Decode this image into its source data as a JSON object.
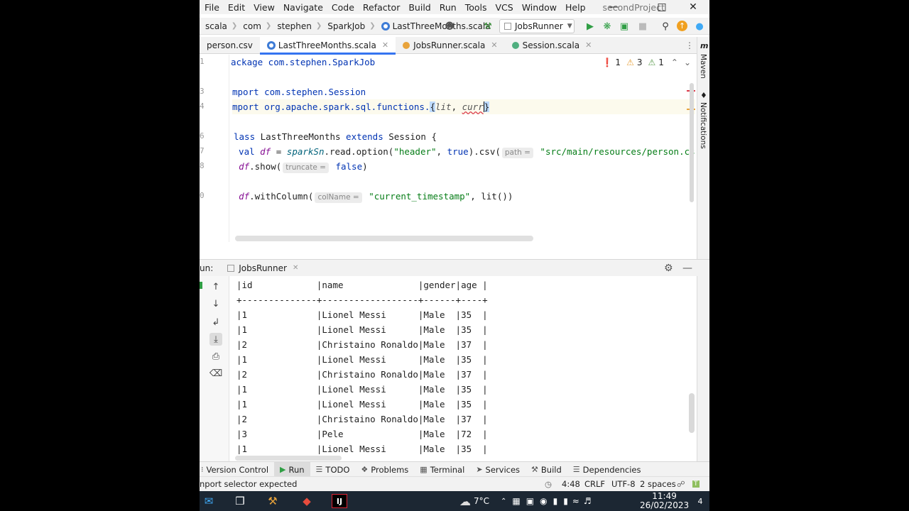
{
  "menu": {
    "items": [
      "File",
      "Edit",
      "View",
      "Navigate",
      "Code",
      "Refactor",
      "Build",
      "Run",
      "Tools",
      "VCS",
      "Window",
      "Help"
    ],
    "project_title": "secondProject"
  },
  "navbar": {
    "crumbs": [
      "scala",
      "com",
      "stephen",
      "SparkJob",
      "LastThreeMonths.scala"
    ],
    "run_config": "JobsRunner"
  },
  "tabs": [
    {
      "label": "person.csv"
    },
    {
      "label": "LastThreeMonths.scala"
    },
    {
      "label": "JobsRunner.scala"
    },
    {
      "label": "Session.scala"
    }
  ],
  "editor": {
    "line_numbers": [
      "1",
      "",
      "3",
      "4",
      "",
      "6",
      "7",
      "8",
      "",
      "0",
      "",
      "",
      ""
    ],
    "issues": {
      "errors": "1",
      "warnings": "3",
      "weak": "1"
    },
    "lines": {
      "l1": {
        "a": "ackage com.stephen.SparkJob"
      },
      "l3": {
        "a": "mport com.stephen.Session"
      },
      "l4": {
        "a": "mport org.apache.spark.sql.functions.",
        "b": "{",
        "c": "lit",
        "d": ", ",
        "e": "curr",
        "f": "}"
      },
      "l6": {
        "a": "lass",
        "b": " LastThreeMonths ",
        "c": "extends",
        "d": " Session {"
      },
      "l7": {
        "a": "  val ",
        "b": "df",
        "c": " = ",
        "d": "sparkSn",
        "e": ".read.option(",
        "f": "\"header\"",
        "g": ", ",
        "h": "true",
        "i": ").csv(",
        "hint": "path =",
        "j": " \"src/main/resources/person.cs"
      },
      "l8": {
        "a": "  ",
        "b": "df",
        "c": ".show(",
        "hint": "truncate =",
        "d": " false",
        "e": ")"
      },
      "l10": {
        "a": "  ",
        "b": "df",
        "c": ".withColumn(",
        "hint": "colName =",
        "d": " \"current_timestamp\"",
        "e": ", lit())"
      }
    }
  },
  "run": {
    "prefix": "un:",
    "config_tab": "JobsRunner",
    "header_line": "|id            |name              |gender|age |",
    "separator_line": "+--------------+------------------+------+----+",
    "rows": [
      "|1             |Lionel Messi      |Male  |35  |",
      "|1             |Lionel Messi      |Male  |35  |",
      "|2             |Christaino Ronaldo|Male  |37  |",
      "|1             |Lionel Messi      |Male  |35  |",
      "|2             |Christaino Ronaldo|Male  |37  |",
      "|1             |Lionel Messi      |Male  |35  |",
      "|1             |Lionel Messi      |Male  |35  |",
      "|2             |Christaino Ronaldo|Male  |37  |",
      "|3             |Pele              |Male  |72  |",
      "|1             |Lionel Messi      |Male  |35  |"
    ]
  },
  "toolwindows": [
    "Version Control",
    "Run",
    "TODO",
    "Problems",
    "Terminal",
    "Services",
    "Build",
    "Dependencies"
  ],
  "status": {
    "message": "nport selector expected",
    "position": "4:48",
    "line_sep": "CRLF",
    "encoding": "UTF-8",
    "indent": "2 spaces"
  },
  "sidebar_right": {
    "maven": "Maven",
    "notifications": "Notifications"
  },
  "taskbar": {
    "temperature": "7°C",
    "time": "11:49",
    "date": "26/02/2023",
    "notif_count": "4"
  },
  "colors": {
    "accent": "#3574f0",
    "keyword": "#0033b3",
    "string": "#067d17",
    "error": "#db3b4b",
    "warning": "#e7a33e"
  }
}
